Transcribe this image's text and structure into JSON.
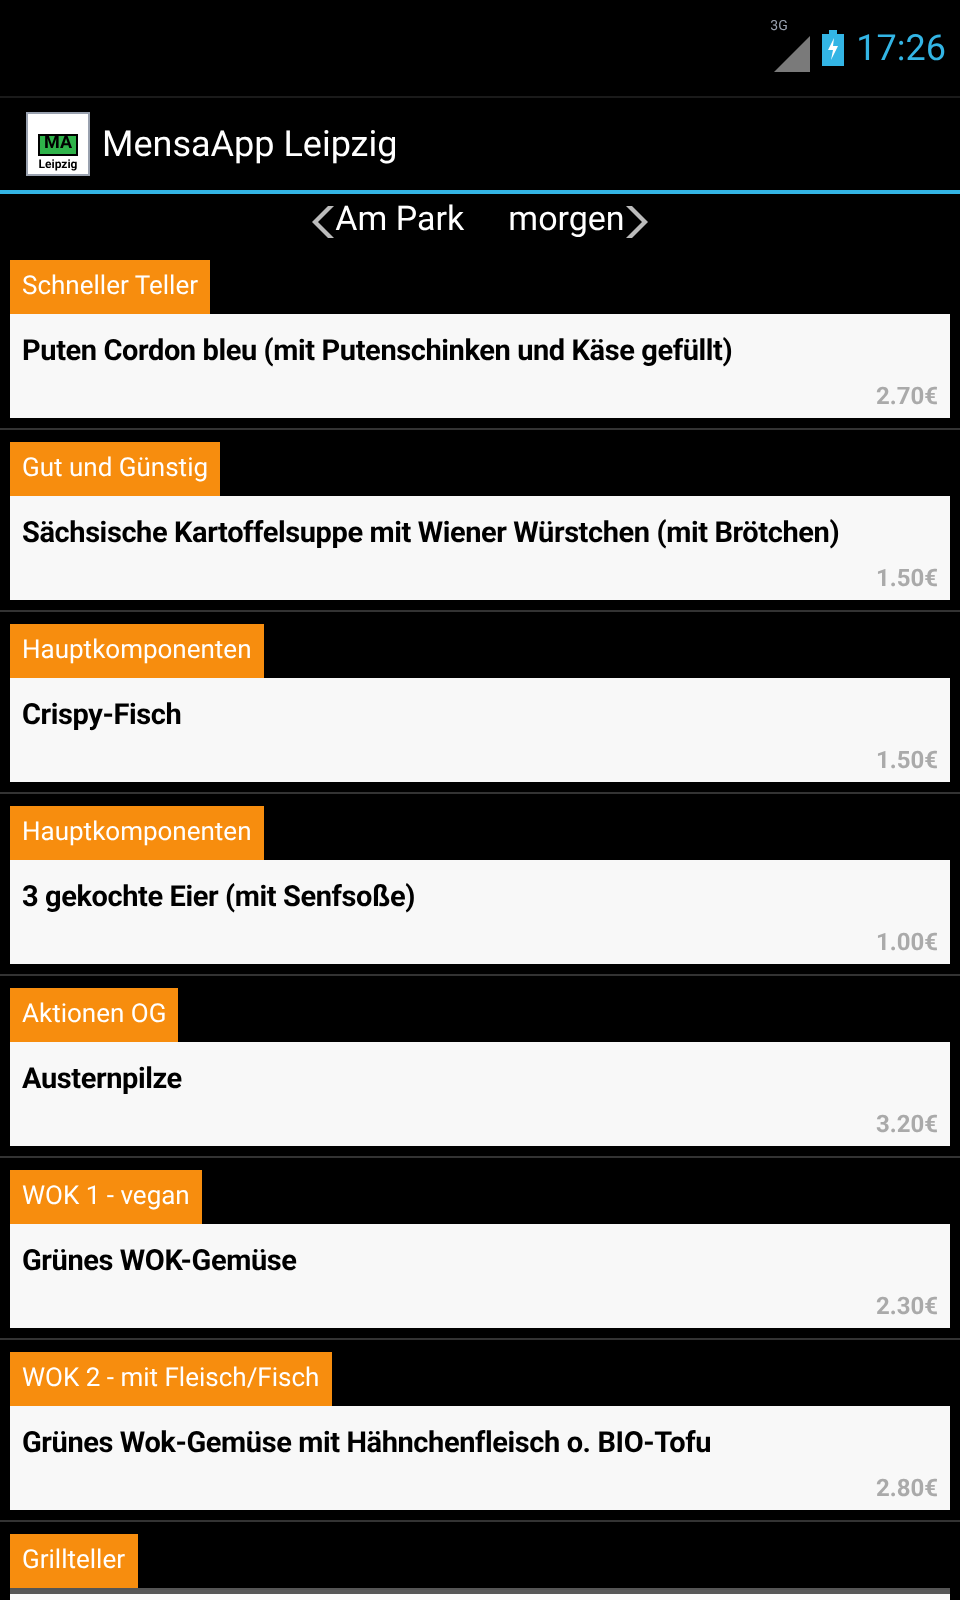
{
  "status_bar": {
    "network": "3G",
    "time": "17:26"
  },
  "action_bar": {
    "logo": {
      "top": "MA",
      "bottom": "Leipzig"
    },
    "title": "MensaApp Leipzig"
  },
  "navigation": {
    "mensa": "Am Park",
    "day": "morgen"
  },
  "meals": [
    {
      "category": "Schneller Teller",
      "dish": "Puten Cordon bleu (mit Putenschinken und Käse gefüllt)",
      "price": "2.70€"
    },
    {
      "category": "Gut und Günstig",
      "dish": "Sächsische Kartoffelsuppe mit Wiener Würstchen (mit Brötchen)",
      "price": "1.50€"
    },
    {
      "category": "Hauptkomponenten",
      "dish": "Crispy-Fisch",
      "price": "1.50€"
    },
    {
      "category": "Hauptkomponenten",
      "dish": "3 gekochte Eier (mit Senfsoße)",
      "price": "1.00€"
    },
    {
      "category": "Aktionen OG",
      "dish": "Austernpilze",
      "price": "3.20€"
    },
    {
      "category": "WOK 1 - vegan",
      "dish": "Grünes WOK-Gemüse",
      "price": "2.30€"
    },
    {
      "category": "WOK 2 - mit Fleisch/Fisch",
      "dish": "Grünes Wok-Gemüse mit Hähnchenfleisch o. BIO-Tofu",
      "price": "2.80€"
    },
    {
      "category": "Grillteller"
    }
  ]
}
